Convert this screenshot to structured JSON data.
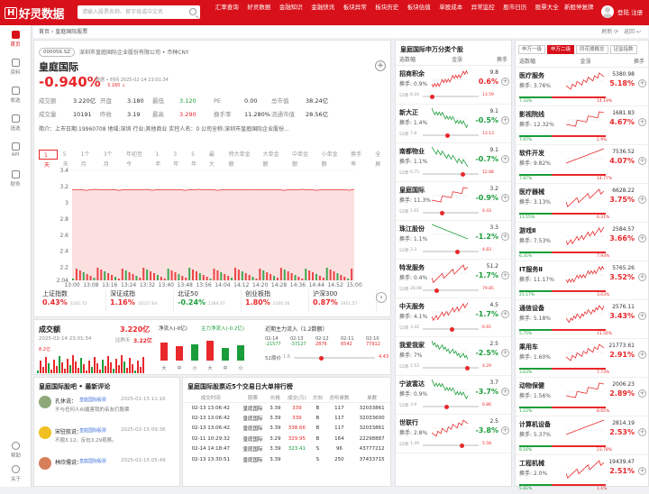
{
  "app": {
    "search_placeholder": "请输入股票名称、首字母或中文名",
    "nav": [
      "汇率查询",
      "好灵数据",
      "金融知识",
      "金融快讯",
      "板块异常",
      "板块历史",
      "板块估值",
      "单股成本",
      "异常监控",
      "股市日历",
      "股票大全",
      "新股停复牌"
    ],
    "login": "登陆 注册",
    "logo": "好灵数据"
  },
  "side": [
    "首页",
    "资料",
    "收选",
    "选选",
    "API",
    "财务"
  ],
  "side_bottom": [
    "帮助",
    "关于"
  ],
  "crumb": {
    "home": "首页",
    "current": "皇庭国际股票",
    "refresh": "刷新",
    "back": "返回"
  },
  "stock": {
    "code": "000056.SZ",
    "company": "深圳市皇庭国际企业股份有限公司 • 币种CNY",
    "name": "皇庭国际",
    "pct": "-0.940%",
    "dt_label": "数据 • 时间 2025-02-14 23:01:34",
    "dt_price": "3.160 ↓",
    "grid": [
      [
        "成交额",
        "3.220亿",
        "开盘",
        "3.180",
        "最低",
        "3.120",
        "PE",
        "0.00",
        "总市值",
        "38.24亿"
      ],
      [
        "成交量",
        "10191",
        "昨收",
        "3.19",
        "最高",
        "3.290",
        "换手率",
        "11.280%",
        "流通市值",
        "28.56亿"
      ]
    ],
    "desc": "简介：上市日期:19960708 地域:深圳 行业:其他商业 实控人名：0 公司全称:深圳市皇庭国际企业股份..."
  },
  "chart_tabs": [
    "1天",
    "5天",
    "1个月",
    "3个月",
    "年初至今",
    "1年",
    "3年",
    "5年",
    "最大",
    "特大单金额",
    "大单金额",
    "中单金额",
    "小单金额",
    "换手率",
    "全屏"
  ],
  "chart_data": {
    "type": "area",
    "x_ticks": [
      "13:00",
      "13:08",
      "13:16",
      "13:24",
      "13:32",
      "13:40",
      "13:48",
      "13:56",
      "14:04",
      "14:12",
      "14:20",
      "14:28",
      "14:36",
      "14:44",
      "14:52",
      "15:00"
    ],
    "y_ticks": [
      "3.4",
      "3.2",
      "3",
      "2.8",
      "2.6",
      "2.4",
      "2.2",
      "2.04"
    ],
    "ylim": [
      2.04,
      3.4
    ],
    "price_level": 3.16
  },
  "indices": [
    {
      "name": "上证指数",
      "value": "0.43%",
      "sub": "3161.72",
      "color": "red"
    },
    {
      "name": "深证成指",
      "value": "1.16%",
      "sub": "10157.64",
      "color": "red"
    },
    {
      "name": "北证50",
      "value": "-0.24%",
      "sub": "1384.37",
      "color": "green"
    },
    {
      "name": "创业板指",
      "value": "1.80%",
      "sub": "2100.56",
      "color": "red"
    },
    {
      "name": "沪深300",
      "value": "0.87%",
      "sub": "3951.57",
      "color": "red"
    }
  ],
  "vol": {
    "title": "成交额",
    "total": "3.220亿",
    "date": "2025-02-14 23:01:34",
    "compare_label": "比昨天",
    "compare_val": "3.22亿",
    "cur": "8.2亿",
    "net_label": "净流入(-0亿)",
    "main_label": "主力净流入(-0.2亿)",
    "recent_label": "近期主力流入（1.2数额）",
    "bars_labels": [
      "大",
      "中",
      "小",
      "大",
      "中",
      "小"
    ],
    "dates": [
      "02-14",
      "02-13",
      "02-12",
      "02-11",
      "02-10"
    ],
    "dates_vals": [
      "-21577",
      "-37127",
      "2876",
      "6542",
      "77912"
    ],
    "hl_label": "52周价",
    "hl_lo": "1.6",
    "hl_hi": "4.43"
  },
  "comments": {
    "title": "皇庭国际股吧 • 最新评论",
    "items": [
      {
        "user": "孔休说：",
        "tag": "皇庭国际股票",
        "time": "2025-02-15 11:16",
        "text": "不与任何人纠缠害我的亲友们股票"
      },
      {
        "user": "宋驻航说：",
        "tag": "皇庭国际股票",
        "time": "2025-02-15 09:36",
        "text": "不顺3.12。反包3.29观察。"
      },
      {
        "user": "林欣儒说：",
        "tag": "皇庭国际股票",
        "time": "2025-02-15 05:49",
        "text": ""
      }
    ]
  },
  "trades": {
    "title": "皇庭国际股票近5个交易日大单排行榜",
    "headers": [
      "成交时间",
      "股票",
      "价格",
      "成交(万)",
      "方向",
      "总听单数",
      "单数"
    ],
    "rows": [
      [
        "02-13 13:06:42",
        "皇庭国际",
        "3.39",
        "339",
        "B",
        "117",
        "32033861"
      ],
      [
        "02-13 13:06:42",
        "皇庭国际",
        "3.39",
        "339",
        "B",
        "117",
        "32033600"
      ],
      [
        "02-13 13:06:42",
        "皇庭国际",
        "3.39",
        "338.66",
        "B",
        "117",
        "32033861"
      ],
      [
        "02-11 10:29:32",
        "皇庭国际",
        "3.29",
        "329.95",
        "B",
        "164",
        "22298887"
      ],
      [
        "02-14 14:18:47",
        "皇庭国际",
        "3.39",
        "323.41",
        "S",
        "96",
        "43777212"
      ],
      [
        "02-13 13:30:51",
        "皇庭国际",
        "3.39",
        "",
        "S",
        "250",
        "37433715"
      ]
    ]
  },
  "mid": {
    "title": "皇庭国际申万分类个股",
    "headers": [
      "选数幅",
      "金涨",
      "换手"
    ],
    "rows": [
      [
        "招商积余",
        "换手: 0.9%",
        "9.8",
        "0.6%",
        "8.16",
        "13.59",
        "red",
        "up"
      ],
      [
        "新大正",
        "换手: 1.4%",
        "9.1",
        "-0.5%",
        "7.8",
        "13.13",
        "green",
        "down"
      ],
      [
        "南都物业",
        "换手: 1.1%",
        "9.1",
        "-0.7%",
        "6.75",
        "12.88",
        "green",
        "down"
      ],
      [
        "皇庭国际",
        "换手: 11.3%",
        "3.2",
        "-0.9%",
        "1.61",
        "4.43",
        "green",
        "up"
      ],
      [
        "珠江股份",
        "换手: 1.1%",
        "3.3",
        "-1.2%",
        "2.3",
        "4.83",
        "green",
        "down"
      ],
      [
        "特发服务",
        "换手: 0.4%",
        "51.2",
        "-1.7%",
        "20.08",
        "79.85",
        "green",
        "up"
      ],
      [
        "中天服务",
        "换手: 4.1%",
        "4.5",
        "-1.7%",
        "3.42",
        "6.91",
        "green",
        "up"
      ],
      [
        "我爱我家",
        "换手: 7%",
        "2.5",
        "-2.5%",
        "1.53",
        "4.29",
        "green",
        "down"
      ],
      [
        "宁波富达",
        "换手: 0.9%",
        "3.7",
        "-3.7%",
        "3.9",
        "6.86",
        "green",
        "down"
      ],
      [
        "世联行",
        "换手: 2.8%",
        "2.5",
        "-3.8%",
        "1.49",
        "5.58",
        "green",
        "up"
      ]
    ]
  },
  "right": {
    "tabs": [
      "申万一级",
      "申万二级",
      "同花顺概念",
      "证监指数"
    ],
    "headers": [
      "选数幅",
      "金涨",
      "换手"
    ],
    "rows": [
      [
        "医疗服务",
        "换手: 3.76%",
        "5380.98",
        "5.18%",
        "7.33%",
        "14.19%"
      ],
      [
        "影视院线",
        "换手: 12.32%",
        "1681.83",
        "4.67%",
        "7.97%",
        "2.9%"
      ],
      [
        "软件开发",
        "换手: 9.82%",
        "7536.52",
        "4.07%",
        "7.87%",
        "14.77%"
      ],
      [
        "医疗器械",
        "换手: 3.13%",
        "6628.22",
        "3.75%",
        "11.55%",
        "6.31%"
      ],
      [
        "游戏Ⅱ",
        "换手: 7.53%",
        "2584.57",
        "3.66%",
        "6.35%",
        "7.93%"
      ],
      [
        "IT服务Ⅱ",
        "换手: 11.17%",
        "5765.26",
        "3.52%",
        "21.17%",
        "3.03%"
      ],
      [
        "通信设备",
        "换手: 5.18%",
        "2576.11",
        "3.43%",
        "5.75%",
        "11.56%"
      ],
      [
        "乘用车",
        "换手: 1.60%",
        "21773.61",
        "2.91%",
        "3.63%",
        "7.73%"
      ],
      [
        "动物保健",
        "换手: 1.56%",
        "2006.23",
        "2.89%",
        "1.22%",
        "8.65%"
      ],
      [
        "计算机设备",
        "换手: 5.37%",
        "2814.19",
        "2.53%",
        "8.16%",
        "23.78%"
      ],
      [
        "工程机械",
        "换手: 2.0%",
        "19439.47",
        "2.51%",
        "5.81%",
        "1.1%"
      ]
    ]
  }
}
